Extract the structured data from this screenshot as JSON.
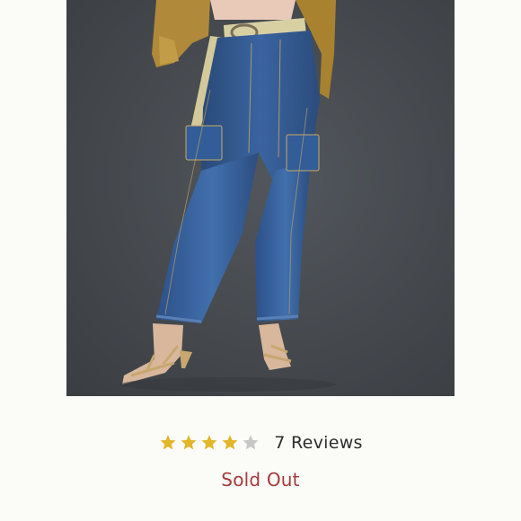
{
  "product": {
    "image_alt": "Model wearing medium-wash straight-leg cargo jeans with a canvas belt and gold strappy heels",
    "rating": 4,
    "rating_max": 5,
    "reviews_label": "7 Reviews",
    "availability": "Sold Out"
  },
  "colors": {
    "star_filled": "#e2b628",
    "star_empty": "#c7c7c7",
    "sold_out": "#a23a3a",
    "background": "#fbfbf7"
  }
}
